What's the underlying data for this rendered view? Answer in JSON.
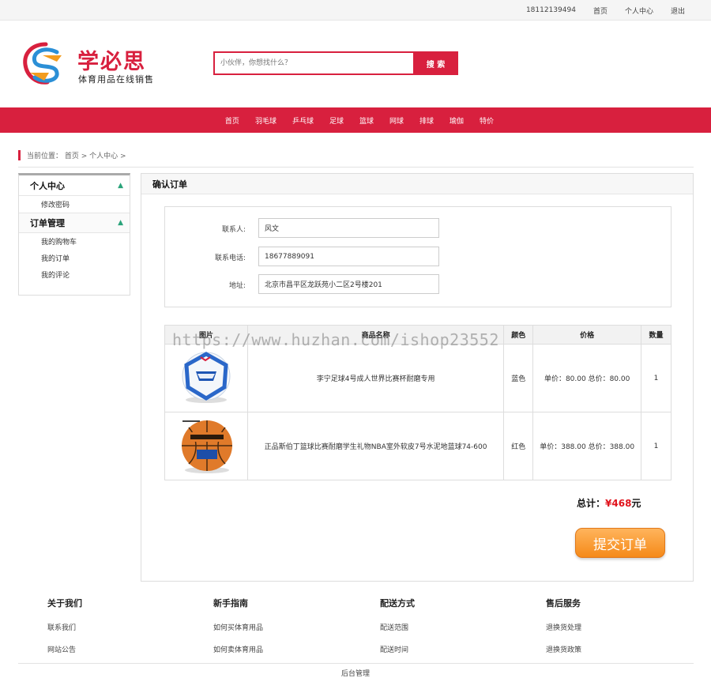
{
  "topbar": {
    "phone": "18112139494",
    "home": "首页",
    "user_center": "个人中心",
    "logout": "退出"
  },
  "brand": {
    "name": "学必思",
    "slogan": "体育用品在线销售",
    "accent": "#d8203e"
  },
  "search": {
    "placeholder": "小伙伴，你想找什么？",
    "button": "搜 索"
  },
  "nav": [
    "首页",
    "羽毛球",
    "乒乓球",
    "足球",
    "篮球",
    "网球",
    "排球",
    "瑜伽",
    "特价"
  ],
  "breadcrumb": "当前位置： 首页 > 个人中心 >",
  "sidebar": {
    "group1": "个人中心",
    "group1_items": [
      "修改密码"
    ],
    "group2": "订单管理",
    "group2_items": [
      "我的购物车",
      "我的订单",
      "我的评论"
    ]
  },
  "main": {
    "title": "确认订单",
    "contact_label": "联系人:",
    "contact_value": "风文",
    "phone_label": "联系电话:",
    "phone_value": "18677889091",
    "address_label": "地址:",
    "address_value": "北京市昌平区龙跃苑小二区2号楼201",
    "columns": [
      "图片",
      "商品名称",
      "颜色",
      "价格",
      "数量"
    ],
    "items": [
      {
        "name": "李宁足球4号成人世界比赛杯耐磨专用",
        "color": "蓝色",
        "price": "单价：80.00  总价：80.00",
        "qty": "1"
      },
      {
        "name": "正品斯伯丁篮球比赛耐磨学生礼物NBA室外软皮7号水泥地蓝球74-600",
        "color": "红色",
        "price": "单价：388.00  总价：388.00",
        "qty": "1"
      }
    ],
    "total_label": "总计：",
    "total_amount": "¥468",
    "total_unit": "元",
    "submit": "提交订单"
  },
  "watermark": "https://www.huzhan.com/ishop23552",
  "footer": {
    "cols": [
      {
        "title": "关于我们",
        "links": [
          "联系我们",
          "网站公告"
        ]
      },
      {
        "title": "新手指南",
        "links": [
          "如何买体育用品",
          "如何卖体育用品"
        ]
      },
      {
        "title": "配送方式",
        "links": [
          "配送范围",
          "配送时间"
        ]
      },
      {
        "title": "售后服务",
        "links": [
          "退换货处理",
          "退换货政策"
        ]
      }
    ],
    "admin": "后台管理"
  }
}
